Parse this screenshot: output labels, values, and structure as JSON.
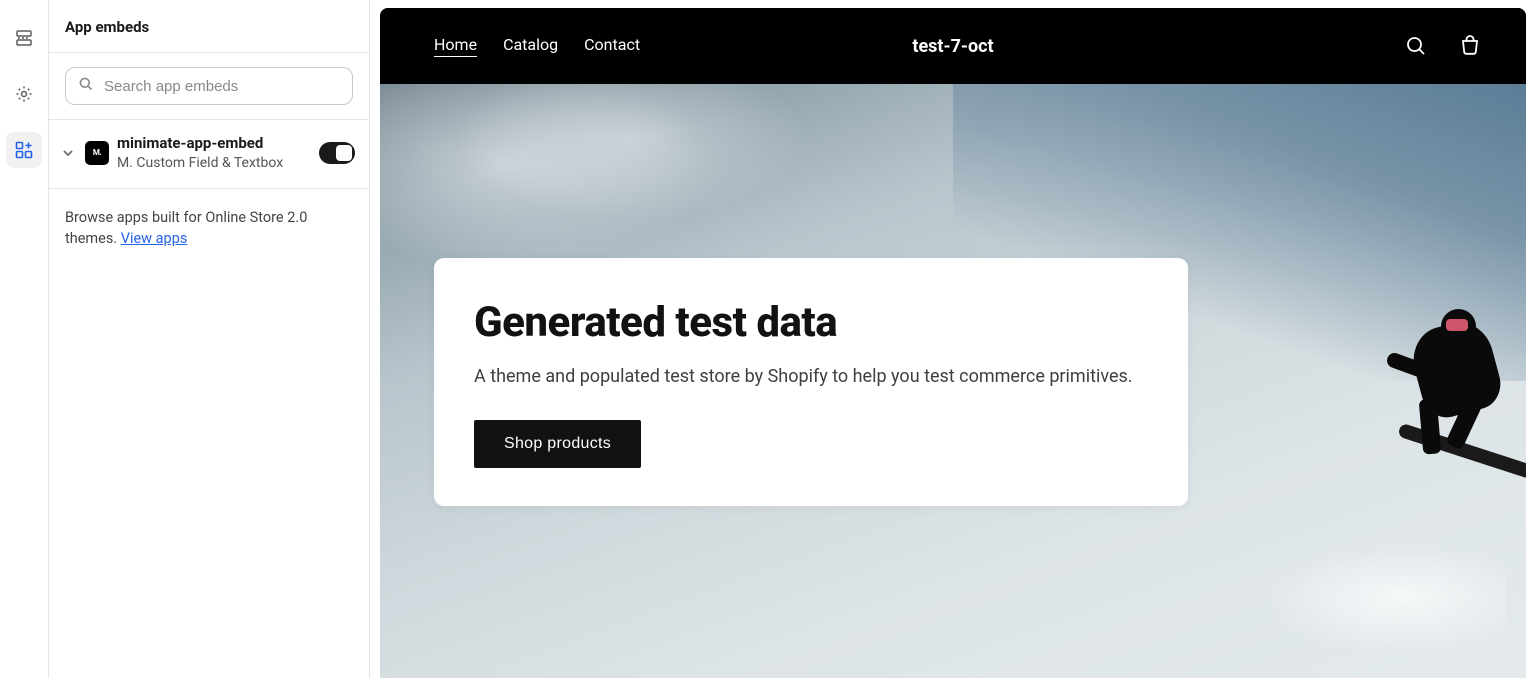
{
  "sidebar": {
    "title": "App embeds",
    "search_placeholder": "Search app embeds",
    "embed": {
      "badge": "M.",
      "name": "minimate-app-embed",
      "subtitle": "M. Custom Field & Textbox"
    },
    "browse_text": "Browse apps built for Online Store 2.0 themes. ",
    "browse_link": "View apps"
  },
  "store": {
    "nav": {
      "home": "Home",
      "catalog": "Catalog",
      "contact": "Contact"
    },
    "title": "test-7-oct",
    "hero": {
      "title": "Generated test data",
      "desc": "A theme and populated test store by Shopify to help you test commerce primitives.",
      "button": "Shop products"
    }
  }
}
